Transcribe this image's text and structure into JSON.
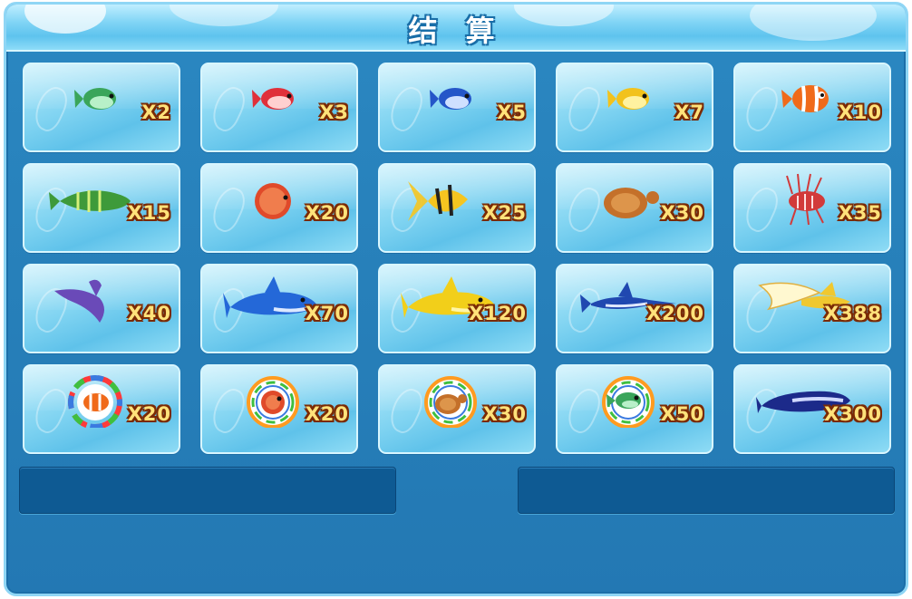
{
  "title": "结 算",
  "cards": [
    {
      "fish": "green-small-fish-icon",
      "multiplier": "X2",
      "body": "#3aa55a",
      "accent": "#b8f0c8"
    },
    {
      "fish": "red-small-fish-icon",
      "multiplier": "X3",
      "body": "#e0303a",
      "accent": "#ffd0d0"
    },
    {
      "fish": "blue-small-fish-icon",
      "multiplier": "X5",
      "body": "#2556c8",
      "accent": "#cfe0ff"
    },
    {
      "fish": "yellow-small-fish-icon",
      "multiplier": "X7",
      "body": "#f2c21c",
      "accent": "#fff2a0"
    },
    {
      "fish": "clownfish-icon",
      "multiplier": "X10",
      "body": "#f06a1a",
      "accent": "#ffffff"
    },
    {
      "fish": "green-striped-fish-icon",
      "multiplier": "X15",
      "body": "#3e9a3a",
      "accent": "#d6f07a"
    },
    {
      "fish": "red-puffer-fish-icon",
      "multiplier": "X20",
      "body": "#e04a2a",
      "accent": "#ffb070"
    },
    {
      "fish": "angelfish-icon",
      "multiplier": "X25",
      "body": "#f5c520",
      "accent": "#222222"
    },
    {
      "fish": "sea-turtle-icon",
      "multiplier": "X30",
      "body": "#c4702a",
      "accent": "#e8a55a"
    },
    {
      "fish": "lionfish-icon",
      "multiplier": "X35",
      "body": "#d23a3a",
      "accent": "#ffe0e0"
    },
    {
      "fish": "manta-ray-icon",
      "multiplier": "X40",
      "body": "#6a4ab8",
      "accent": "#b8a8f0"
    },
    {
      "fish": "blue-shark-icon",
      "multiplier": "X70",
      "body": "#2468d8",
      "accent": "#dbe8ff"
    },
    {
      "fish": "golden-shark-icon",
      "multiplier": "X120",
      "body": "#f2cf1a",
      "accent": "#fff6a8"
    },
    {
      "fish": "swordfish-icon",
      "multiplier": "X200",
      "body": "#2048b0",
      "accent": "#e0e8ff"
    },
    {
      "fish": "golden-dragon-fish-icon",
      "multiplier": "X388",
      "body": "#f0c830",
      "accent": "#fff8d0"
    },
    {
      "fish": "clownfish-bomb-ring-icon",
      "multiplier": "X20",
      "body": "#f06a1a",
      "accent": "#ffffff"
    },
    {
      "fish": "puffer-ring-icon",
      "multiplier": "X20",
      "body": "#e04a2a",
      "accent": "#ffb070"
    },
    {
      "fish": "turtle-ring-icon",
      "multiplier": "X30",
      "body": "#c4702a",
      "accent": "#e8a55a"
    },
    {
      "fish": "green-fish-ring-icon",
      "multiplier": "X50",
      "body": "#3aa55a",
      "accent": "#b8f0c8"
    },
    {
      "fish": "blue-whale-icon",
      "multiplier": "X300",
      "body": "#1c2a8a",
      "accent": "#cfd8ff"
    }
  ],
  "colors": {
    "panel": "#2780ba",
    "card": "#7fd3f1",
    "multiplier_text": "#ffe27a",
    "footer_box": "#0e5a93"
  }
}
